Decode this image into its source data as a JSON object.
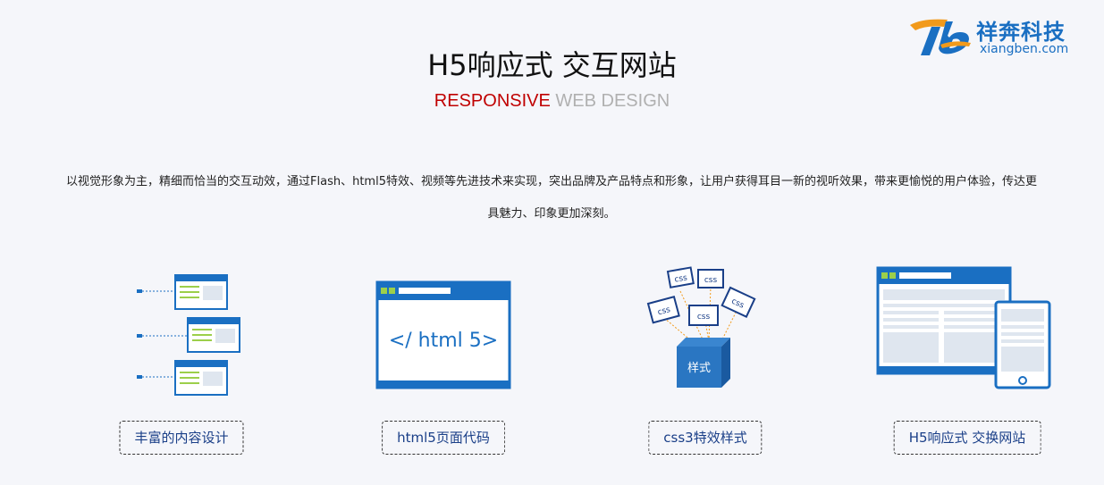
{
  "brand": {
    "name_cn": "祥奔科技",
    "domain": "xiangben.com",
    "colors": {
      "blue": "#1a6fc2",
      "orange": "#f29a1b"
    }
  },
  "hero": {
    "title": "H5响应式 交互网站",
    "subtitle_red": "RESPONSIVE",
    "subtitle_gray": "WEB DESIGN"
  },
  "description": {
    "line1": "以视觉形象为主，精细而恰当的交互动效，通过Flash、html5特效、视频等先进技术来实现，突出品牌及产品特点和形象，让用户获得耳目一新的视听效果，带来更愉悦的用户体验，传达更",
    "line2": "具魅力、印象更加深刻。"
  },
  "features": [
    {
      "icon": "multi-window-icon",
      "label": "丰富的内容设计"
    },
    {
      "icon": "html5-window-icon",
      "label": "html5页面代码",
      "icon_text": "</ html 5>"
    },
    {
      "icon": "css-cube-icon",
      "label": "css3特效样式",
      "icon_text": "样式",
      "tag": "css"
    },
    {
      "icon": "responsive-devices-icon",
      "label": "H5响应式 交换网站"
    }
  ]
}
